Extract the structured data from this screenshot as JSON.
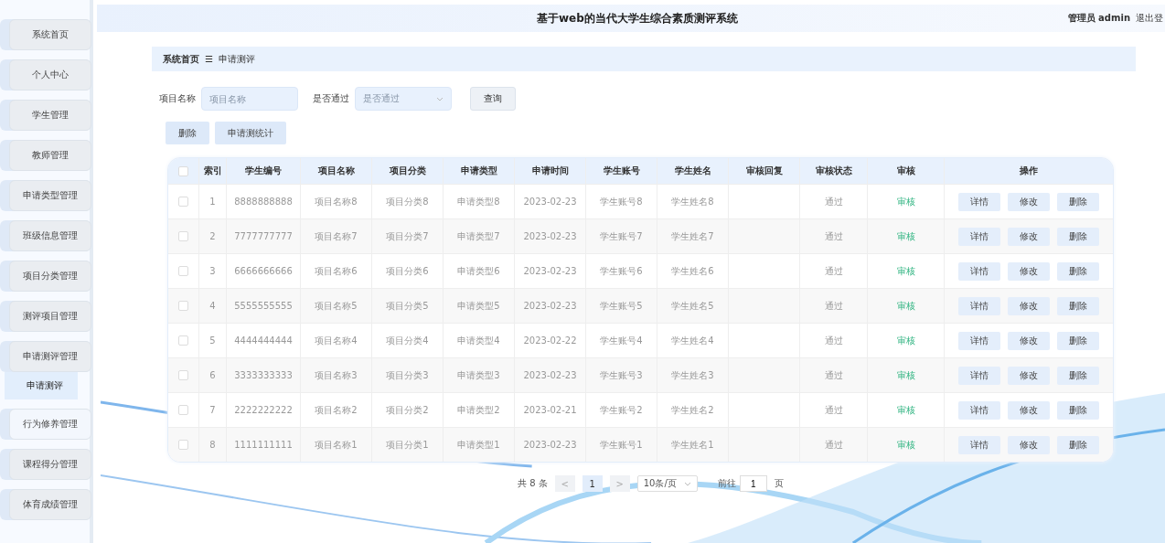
{
  "header": {
    "title": "基于web的当代大学生综合素质测评系统",
    "user": "管理员 admin",
    "logout": "退出登"
  },
  "sidebar": {
    "items": [
      {
        "label": "系统首页",
        "hovered": false
      },
      {
        "label": "个人中心",
        "hovered": false
      },
      {
        "label": "学生管理",
        "hovered": false
      },
      {
        "label": "教师管理",
        "hovered": false
      },
      {
        "label": "申请类型管理",
        "hovered": false
      },
      {
        "label": "班级信息管理",
        "hovered": false
      },
      {
        "label": "项目分类管理",
        "hovered": false
      },
      {
        "label": "测评项目管理",
        "hovered": false
      },
      {
        "label": "申请测评管理",
        "hovered": false,
        "children": [
          {
            "label": "申请测评",
            "selected": true
          }
        ]
      },
      {
        "label": "行为修养管理",
        "hovered": true
      },
      {
        "label": "课程得分管理",
        "hovered": false
      },
      {
        "label": "体育成绩管理",
        "hovered": false
      }
    ]
  },
  "breadcrumb": {
    "items": [
      "系统首页",
      "申请测评"
    ],
    "separator": "☰"
  },
  "filters": [
    {
      "kind": "input",
      "label": "项目名称",
      "placeholder": "项目名称"
    },
    {
      "kind": "select",
      "label": "是否通过",
      "placeholder": "是否通过"
    }
  ],
  "search_button": "查询",
  "actions": [
    "删除",
    "申请测统计"
  ],
  "table": {
    "all_checked": false,
    "columns": [
      "索引",
      "学生编号",
      "项目名称",
      "项目分类",
      "申请类型",
      "申请时间",
      "学生账号",
      "学生姓名",
      "审核回复",
      "审核状态",
      "审核",
      "操作"
    ],
    "rows": [
      {
        "checked": false,
        "cells": [
          "1",
          "8888888888",
          "项目名称8",
          "项目分类8",
          "申请类型8",
          "2023-02-23",
          "学生账号8",
          "学生姓名8",
          "",
          "通过"
        ],
        "review": "审核",
        "actions": [
          "详情",
          "修改",
          "删除"
        ]
      },
      {
        "checked": false,
        "cells": [
          "2",
          "7777777777",
          "项目名称7",
          "项目分类7",
          "申请类型7",
          "2023-02-23",
          "学生账号7",
          "学生姓名7",
          "",
          "通过"
        ],
        "review": "审核",
        "actions": [
          "详情",
          "修改",
          "删除"
        ]
      },
      {
        "checked": false,
        "cells": [
          "3",
          "6666666666",
          "项目名称6",
          "项目分类6",
          "申请类型6",
          "2023-02-23",
          "学生账号6",
          "学生姓名6",
          "",
          "通过"
        ],
        "review": "审核",
        "actions": [
          "详情",
          "修改",
          "删除"
        ]
      },
      {
        "checked": false,
        "cells": [
          "4",
          "5555555555",
          "项目名称5",
          "项目分类5",
          "申请类型5",
          "2023-02-23",
          "学生账号5",
          "学生姓名5",
          "",
          "通过"
        ],
        "review": "审核",
        "actions": [
          "详情",
          "修改",
          "删除"
        ]
      },
      {
        "checked": false,
        "cells": [
          "5",
          "4444444444",
          "项目名称4",
          "项目分类4",
          "申请类型4",
          "2023-02-22",
          "学生账号4",
          "学生姓名4",
          "",
          "通过"
        ],
        "review": "审核",
        "actions": [
          "详情",
          "修改",
          "删除"
        ]
      },
      {
        "checked": false,
        "cells": [
          "6",
          "3333333333",
          "项目名称3",
          "项目分类3",
          "申请类型3",
          "2023-02-23",
          "学生账号3",
          "学生姓名3",
          "",
          "通过"
        ],
        "review": "审核",
        "actions": [
          "详情",
          "修改",
          "删除"
        ]
      },
      {
        "checked": false,
        "cells": [
          "7",
          "2222222222",
          "项目名称2",
          "项目分类2",
          "申请类型2",
          "2023-02-21",
          "学生账号2",
          "学生姓名2",
          "",
          "通过"
        ],
        "review": "审核",
        "actions": [
          "详情",
          "修改",
          "删除"
        ]
      },
      {
        "checked": false,
        "cells": [
          "8",
          "1111111111",
          "项目名称1",
          "项目分类1",
          "申请类型1",
          "2023-02-23",
          "学生账号1",
          "学生姓名1",
          "",
          "通过"
        ],
        "review": "审核",
        "actions": [
          "详情",
          "修改",
          "删除"
        ]
      }
    ]
  },
  "pagination": {
    "total": "共 8 条",
    "prev": "<",
    "pages": [
      {
        "label": "1",
        "selected": true
      }
    ],
    "next": ">",
    "page_size": "10条/页",
    "goto_label": "前往",
    "goto_value": "1",
    "goto_unit": "页"
  }
}
